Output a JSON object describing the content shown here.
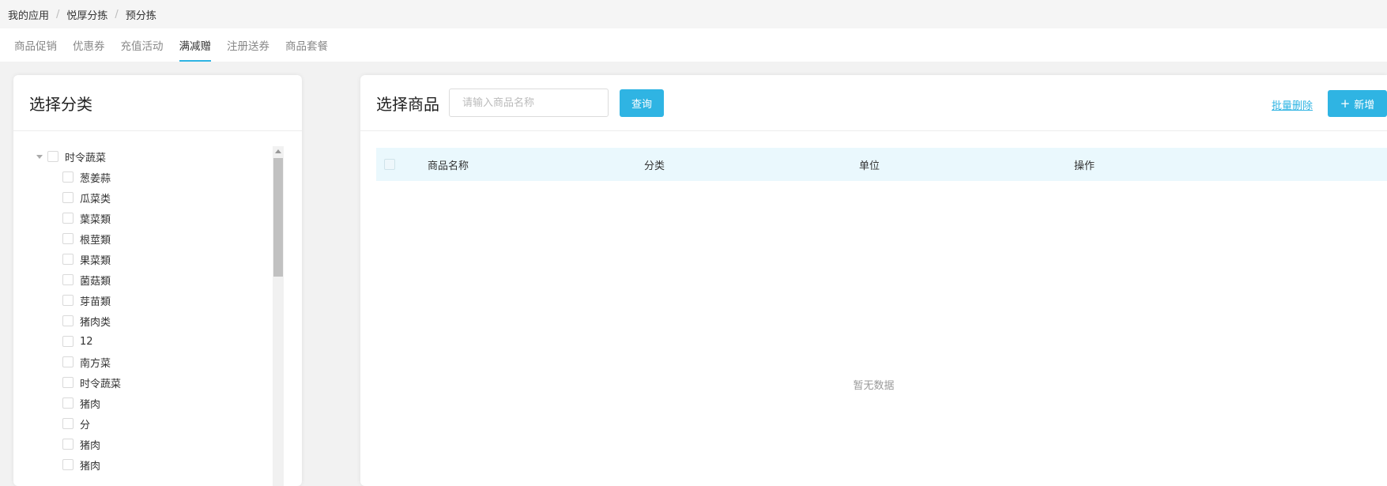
{
  "breadcrumb": [
    "我的应用",
    "悦厚分拣",
    "预分拣"
  ],
  "tabs": [
    {
      "label": "商品促销",
      "active": false
    },
    {
      "label": "优惠券",
      "active": false
    },
    {
      "label": "充值活动",
      "active": false
    },
    {
      "label": "满减赠",
      "active": true
    },
    {
      "label": "注册送券",
      "active": false
    },
    {
      "label": "商品套餐",
      "active": false
    }
  ],
  "category_panel": {
    "title": "选择分类",
    "root": "时令蔬菜",
    "children": [
      "葱姜蒜",
      "瓜菜类",
      "葉菜類",
      "根莖類",
      "果菜類",
      "菌菇類",
      "芽苗類",
      "猪肉类",
      "12",
      "南方菜",
      "时令蔬菜",
      "猪肉",
      "分",
      "猪肉",
      "猪肉"
    ]
  },
  "product_panel": {
    "title": "选择商品",
    "search_placeholder": "请输入商品名称",
    "query_label": "查询",
    "batch_delete_label": "批量删除",
    "add_label": "新增",
    "columns": [
      "商品名称",
      "分类",
      "单位",
      "操作"
    ],
    "empty_text": "暂无数据"
  },
  "colors": {
    "accent": "#2fb4e3",
    "table_header_bg": "#eaf8fd"
  }
}
